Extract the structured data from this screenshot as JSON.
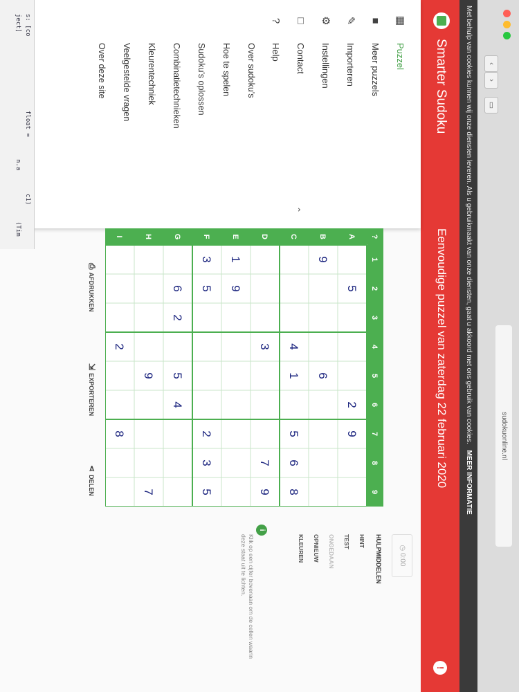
{
  "browser": {
    "url": "sudokuonline.nl",
    "tab_title": "sudokuonline.nl"
  },
  "cookie_bar": {
    "text": "Met behulp van cookies kunnen wij onze diensten leveren. Als u gebruikmaakt van onze diensten, gaat u akkoord met ons gebruik van cookies.",
    "more_label": "MEER INFORMATIE"
  },
  "code_glimpse": [
    "s: [co",
    "ject]",
    "float =",
    "n.a",
    "c1)",
    "(Tim"
  ],
  "app": {
    "title": "Smarter Sudoku",
    "puzzle_title": "Eenvoudige puzzel van zaterdag 22 februari 2020",
    "header_color": "#e53935",
    "accent_color": "#4caf50"
  },
  "sidebar": {
    "items": [
      {
        "label": "Puzzel",
        "icon": "grid-icon"
      },
      {
        "label": "Meer puzzels",
        "icon": "folder-icon"
      },
      {
        "label": "Importeren",
        "icon": "pencil-icon"
      },
      {
        "label": "Instellingen",
        "icon": "gear-icon"
      },
      {
        "label": "Contact",
        "icon": "square-icon"
      },
      {
        "label": "Help",
        "icon": "help-icon"
      }
    ],
    "help_items": [
      "Over sudoku's",
      "Hoe te spelen",
      "Sudoku's oplossen",
      "Combinatietechnieken",
      "Kleurentechniek",
      "Veelgestelde vragen",
      "Over deze site"
    ]
  },
  "board": {
    "col_headers": [
      "1",
      "2",
      "3",
      "4",
      "5",
      "6",
      "7",
      "8",
      "9"
    ],
    "row_headers": [
      "A",
      "B",
      "C",
      "D",
      "E",
      "F",
      "G",
      "H",
      "I"
    ],
    "grid": [
      [
        "",
        "5",
        "",
        "",
        "",
        "2",
        "9",
        "",
        ""
      ],
      [
        "9",
        "",
        "",
        "",
        "6",
        "",
        "",
        "",
        ""
      ],
      [
        "",
        "",
        "",
        "4",
        "1",
        "",
        "5",
        "6",
        "8"
      ],
      [
        "",
        "",
        "",
        "3",
        "",
        "",
        "",
        "7",
        "9"
      ],
      [
        "1",
        "9",
        "",
        "",
        "",
        "",
        "",
        "",
        ""
      ],
      [
        "3",
        "5",
        "",
        "",
        "",
        "",
        "2",
        "3",
        "5"
      ],
      [
        "",
        "6",
        "2",
        "",
        "5",
        "4",
        "",
        "",
        ""
      ],
      [
        "",
        "",
        "",
        "",
        "9",
        "",
        "",
        "",
        "7"
      ],
      [
        "",
        "",
        "",
        "2",
        "",
        "",
        "8",
        "",
        ""
      ]
    ]
  },
  "actions": {
    "print": "AFDRUKKEN",
    "export": "EXPORTEREN",
    "share": "DELEN"
  },
  "right_panel": {
    "timer": "0:00",
    "helpers_heading": "HULPMIDDELEN",
    "helpers": [
      {
        "label": "HINT",
        "enabled": true
      },
      {
        "label": "TEST",
        "enabled": true
      },
      {
        "label": "ONGEDAAN",
        "enabled": false
      },
      {
        "label": "OPNIEUW",
        "enabled": true
      },
      {
        "label": "KLEUREN",
        "enabled": true
      }
    ],
    "tip": "Klik op een cijfer bovenaan om de cellen waarin deze staat uit te lichten."
  }
}
